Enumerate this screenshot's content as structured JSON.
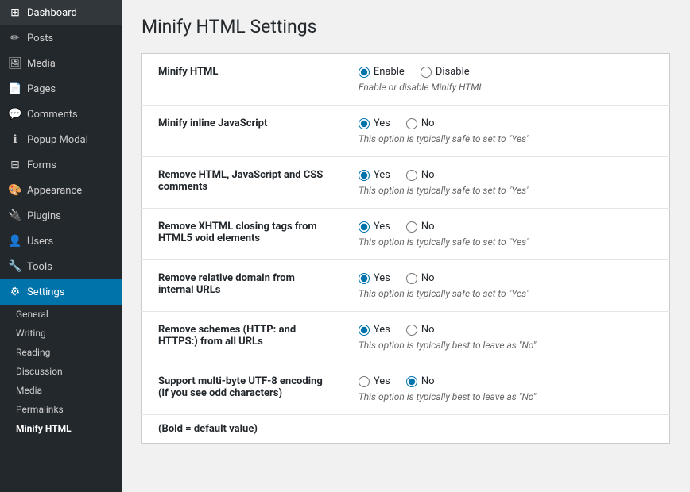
{
  "sidebar": {
    "items": [
      {
        "id": "dashboard",
        "label": "Dashboard",
        "icon": "⊞"
      },
      {
        "id": "posts",
        "label": "Posts",
        "icon": "✏"
      },
      {
        "id": "media",
        "label": "Media",
        "icon": "🖼"
      },
      {
        "id": "pages",
        "label": "Pages",
        "icon": "📄"
      },
      {
        "id": "comments",
        "label": "Comments",
        "icon": "💬"
      },
      {
        "id": "popup-modal",
        "label": "Popup Modal",
        "icon": "ℹ"
      },
      {
        "id": "forms",
        "label": "Forms",
        "icon": "⊟"
      },
      {
        "id": "appearance",
        "label": "Appearance",
        "icon": "🎨"
      },
      {
        "id": "plugins",
        "label": "Plugins",
        "icon": "🔌"
      },
      {
        "id": "users",
        "label": "Users",
        "icon": "👤"
      },
      {
        "id": "tools",
        "label": "Tools",
        "icon": "🔧"
      },
      {
        "id": "settings",
        "label": "Settings",
        "icon": "⚙"
      }
    ],
    "submenu": [
      {
        "id": "general",
        "label": "General"
      },
      {
        "id": "writing",
        "label": "Writing"
      },
      {
        "id": "reading",
        "label": "Reading"
      },
      {
        "id": "discussion",
        "label": "Discussion"
      },
      {
        "id": "media",
        "label": "Media"
      },
      {
        "id": "permalinks",
        "label": "Permalinks"
      },
      {
        "id": "minify-html",
        "label": "Minify HTML"
      }
    ]
  },
  "page": {
    "title": "Minify HTML Settings"
  },
  "settings": [
    {
      "label": "Minify HTML",
      "options": [
        "Enable",
        "Disable"
      ],
      "selected": "Enable",
      "hint": "Enable or disable Minify HTML"
    },
    {
      "label": "Minify inline JavaScript",
      "options": [
        "Yes",
        "No"
      ],
      "selected": "Yes",
      "hint": "This option is typically safe to set to \"Yes\""
    },
    {
      "label": "Remove HTML, JavaScript and CSS comments",
      "options": [
        "Yes",
        "No"
      ],
      "selected": "Yes",
      "hint": "This option is typically safe to set to \"Yes\""
    },
    {
      "label": "Remove XHTML closing tags from HTML5 void elements",
      "options": [
        "Yes",
        "No"
      ],
      "selected": "Yes",
      "hint": "This option is typically safe to set to \"Yes\""
    },
    {
      "label": "Remove relative domain from internal URLs",
      "options": [
        "Yes",
        "No"
      ],
      "selected": "Yes",
      "hint": "This option is typically safe to set to \"Yes\""
    },
    {
      "label": "Remove schemes (HTTP: and HTTPS:) from all URLs",
      "options": [
        "Yes",
        "No"
      ],
      "selected": "Yes",
      "hint": "This option is typically best to leave as \"No\""
    },
    {
      "label": "Support multi-byte UTF-8 encoding (if you see odd characters)",
      "options": [
        "Yes",
        "No"
      ],
      "selected": "No",
      "hint": "This option is typically best to leave as \"No\""
    }
  ],
  "note": "(Bold = default value)"
}
